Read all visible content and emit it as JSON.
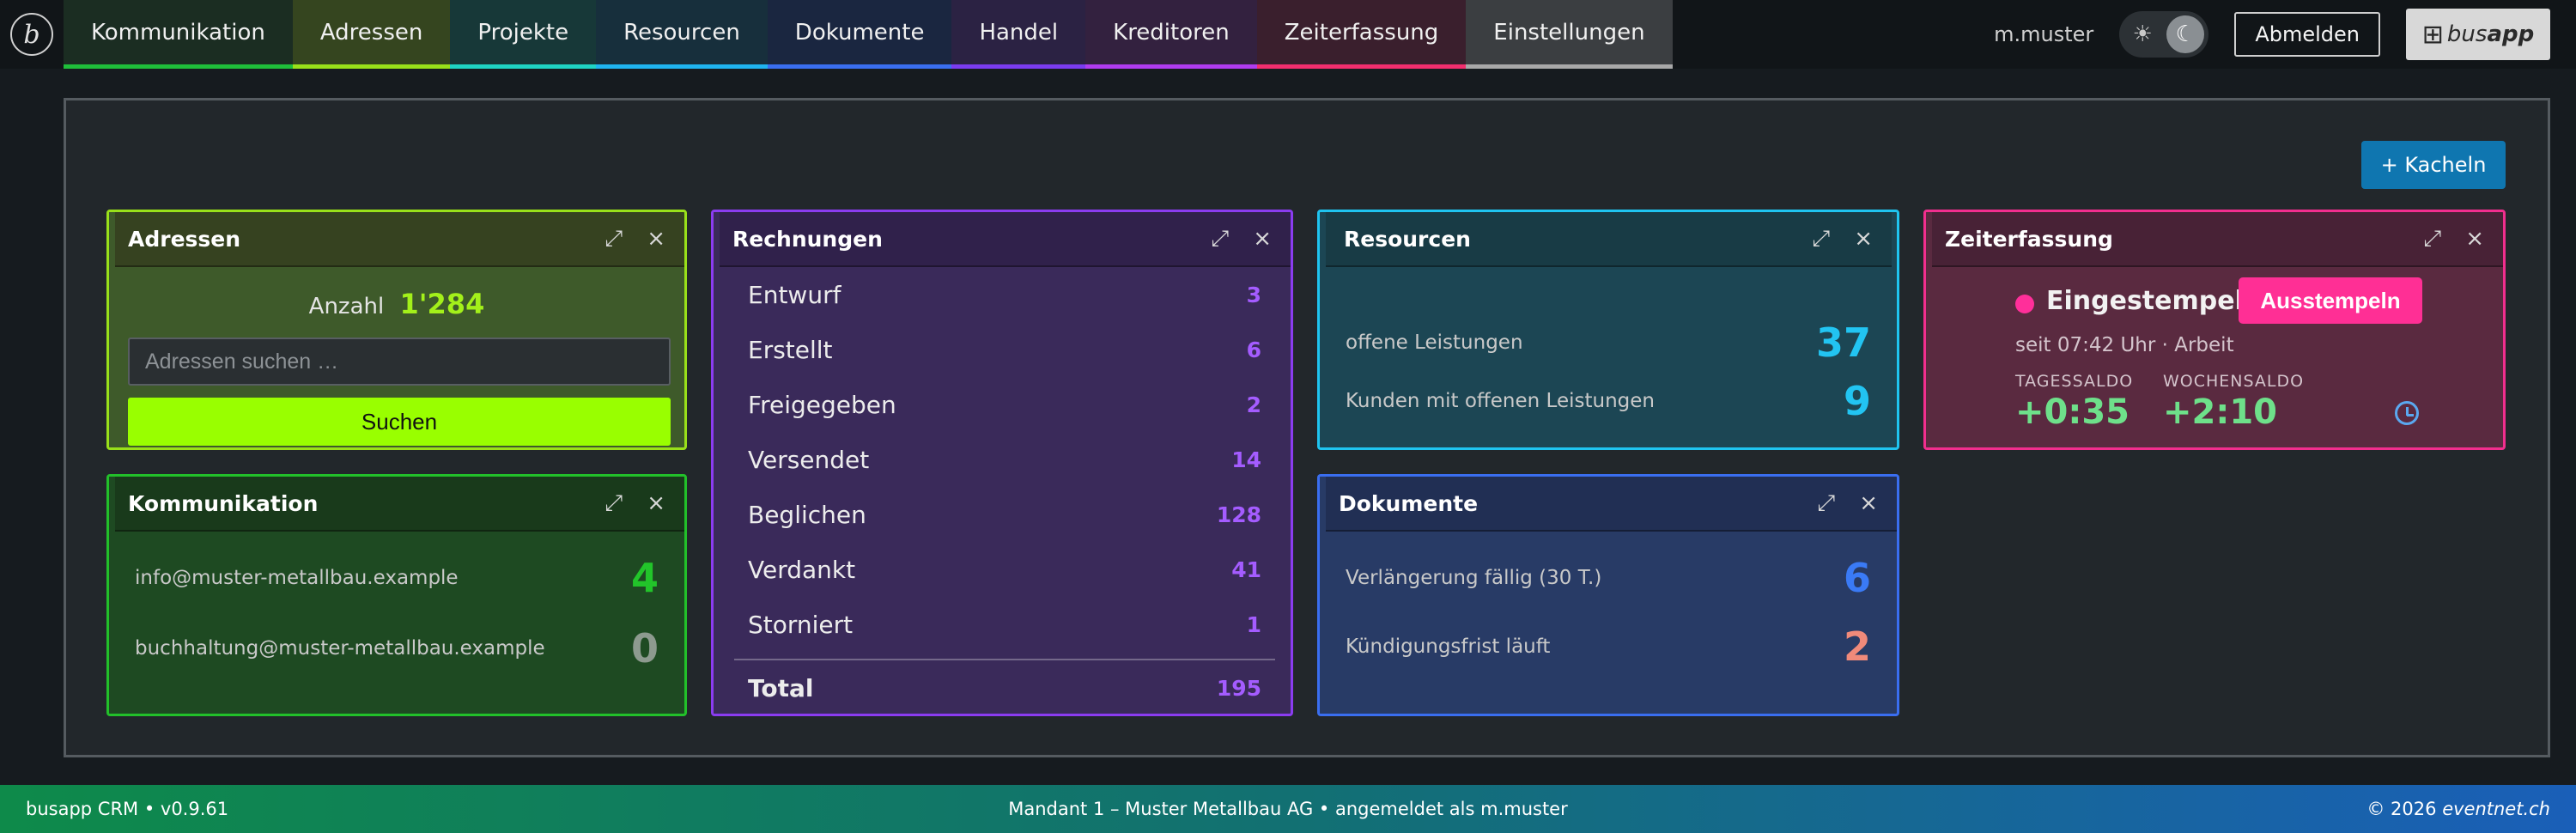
{
  "nav": {
    "logo_letter": "b",
    "tabs": [
      {
        "label": "Kommunikation",
        "bg": "#1b2d22",
        "accent": "#1fbf3a"
      },
      {
        "label": "Adressen",
        "bg": "#35451f",
        "accent": "#99e01a"
      },
      {
        "label": "Projekte",
        "bg": "#173838",
        "accent": "#1fd4c4"
      },
      {
        "label": "Resourcen",
        "bg": "#172f3c",
        "accent": "#1fb4f0"
      },
      {
        "label": "Dokumente",
        "bg": "#1a2640",
        "accent": "#3a6ef0"
      },
      {
        "label": "Handel",
        "bg": "#2b2243",
        "accent": "#7b3cf0"
      },
      {
        "label": "Kreditoren",
        "bg": "#33213f",
        "accent": "#b03cf0"
      },
      {
        "label": "Zeiterfassung",
        "bg": "#3a1f2d",
        "accent": "#f22e6e"
      },
      {
        "label": "Einstellungen",
        "bg": "#3b3e41",
        "accent": "#a8a8a8"
      }
    ],
    "username": "m.muster",
    "theme_light_icon": "☀",
    "theme_dark_icon": "☾",
    "logout_label": "Abmelden",
    "brand_name_light": "bus",
    "brand_name_bold": "app"
  },
  "toolbar": {
    "add_tiles_label": "+ Kacheln"
  },
  "widgets": {
    "adressen": {
      "title": "Adressen",
      "count_label": "Anzahl",
      "count_value": "1'284",
      "search_placeholder": "Adressen suchen …",
      "search_button": "Suchen"
    },
    "kommunikation": {
      "title": "Kommunikation",
      "rows": [
        {
          "label": "info@muster-metallbau.example",
          "value": "4",
          "color": "#22c42a"
        },
        {
          "label": "buchhaltung@muster-metallbau.example",
          "value": "0",
          "color": "#8d9a8f"
        }
      ]
    },
    "rechnungen": {
      "title": "Rechnungen",
      "rows": [
        {
          "label": "Entwurf",
          "value": "3"
        },
        {
          "label": "Erstellt",
          "value": "6"
        },
        {
          "label": "Freigegeben",
          "value": "2"
        },
        {
          "label": "Versendet",
          "value": "14"
        },
        {
          "label": "Beglichen",
          "value": "128"
        },
        {
          "label": "Verdankt",
          "value": "41"
        },
        {
          "label": "Storniert",
          "value": "1"
        }
      ],
      "total_label": "Total",
      "total_value": "195"
    },
    "resourcen": {
      "title": "Resourcen",
      "rows": [
        {
          "label": "offene Leistungen",
          "value": "37"
        },
        {
          "label": "Kunden mit offenen Leistungen",
          "value": "9"
        }
      ]
    },
    "dokumente": {
      "title": "Dokumente",
      "rows": [
        {
          "label": "Verlängerung fällig (30 T.)",
          "value": "6",
          "color": "#3a7af5"
        },
        {
          "label": "Kündigungsfrist läuft",
          "value": "2",
          "color": "#f08a7a"
        }
      ]
    },
    "zeiterfassung": {
      "title": "Zeiterfassung",
      "status": "Eingestempelt",
      "clockout_button": "Ausstempeln",
      "since": "seit 07:42 Uhr · Arbeit",
      "day_label": "TAGESSALDO",
      "day_value": "+0:35",
      "week_label": "WOCHENSALDO",
      "week_value": "+2:10"
    }
  },
  "controls": {
    "expand_icon": "⤢",
    "close_icon": "×"
  },
  "footer": {
    "left": "busapp CRM • v0.9.61",
    "center": "Mandant 1 – Muster Metallbau AG • angemeldet als m.muster",
    "right_prefix": "© 2026",
    "right_brand": "eventnet.ch"
  }
}
